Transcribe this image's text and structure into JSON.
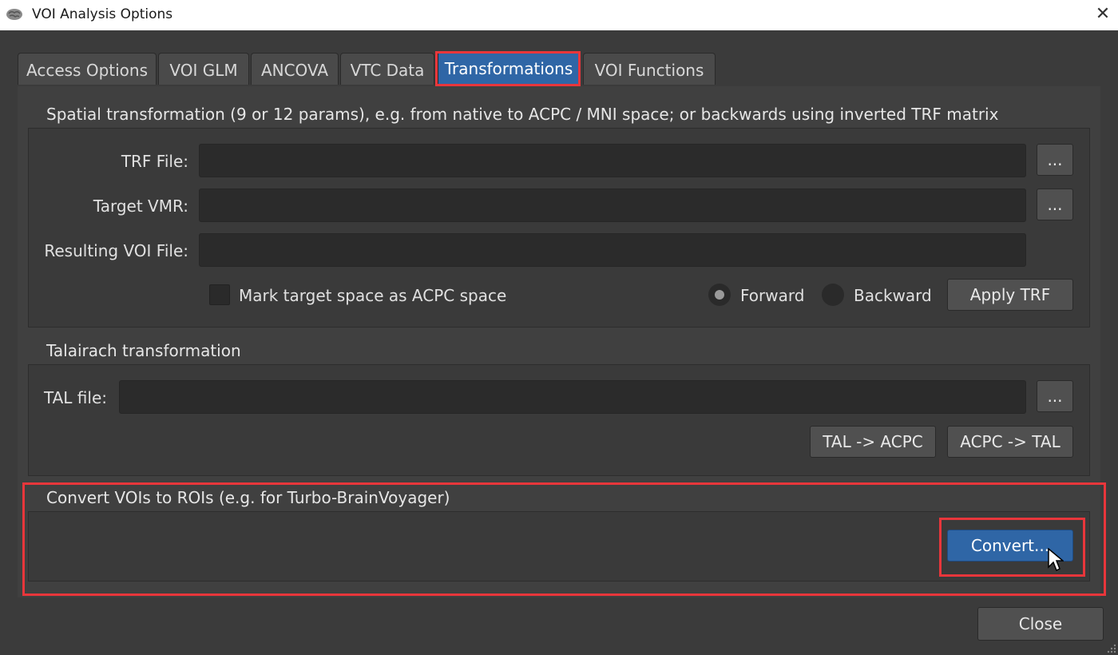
{
  "window": {
    "title": "VOI Analysis Options",
    "close_glyph": "✕"
  },
  "tabs": [
    {
      "label": "Access Options"
    },
    {
      "label": "VOI GLM"
    },
    {
      "label": "ANCOVA"
    },
    {
      "label": "VTC Data"
    },
    {
      "label": "Transformations",
      "active": true
    },
    {
      "label": "VOI Functions"
    }
  ],
  "spatial": {
    "title": "Spatial transformation (9 or 12 params), e.g. from native to ACPC / MNI space; or backwards using inverted TRF matrix",
    "trf_label": "TRF File:",
    "trf_value": "",
    "target_label": "Target VMR:",
    "target_value": "",
    "result_label": "Resulting VOI File:",
    "result_value": "",
    "browse_label": "...",
    "acpc_checkbox_label": "Mark target space as ACPC space",
    "forward_label": "Forward",
    "backward_label": "Backward",
    "apply_label": "Apply TRF"
  },
  "talairach": {
    "title": "Talairach transformation",
    "tal_label": "TAL file:",
    "tal_value": "",
    "browse_label": "...",
    "tal_to_acpc_label": "TAL -> ACPC",
    "acpc_to_tal_label": "ACPC -> TAL"
  },
  "convert": {
    "title": "Convert VOIs to ROIs (e.g. for Turbo-BrainVoyager)",
    "button_label": "Convert..."
  },
  "footer": {
    "close_label": "Close"
  },
  "colors": {
    "highlight": "#e8363b",
    "accent": "#2f66a6",
    "background": "#3b3b3b"
  }
}
